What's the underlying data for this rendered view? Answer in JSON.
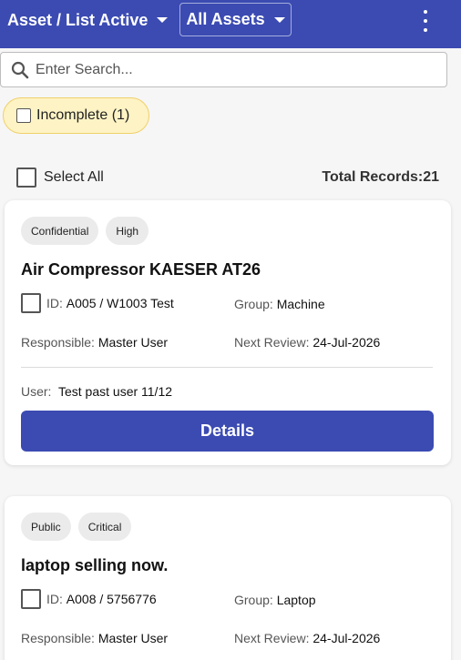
{
  "topbar": {
    "title": "Asset / List Active",
    "asset_filter": "All Assets",
    "icons": {
      "title_caret": "chevron-down-icon",
      "filter_caret": "chevron-down-icon",
      "menu": "more-vert-icon"
    },
    "color": "#3b4bb2"
  },
  "search": {
    "placeholder": "Enter Search...",
    "value": "",
    "icon": "search-icon"
  },
  "incomplete_chip": {
    "label": "Incomplete (1)",
    "checked": false
  },
  "select_all": {
    "label": "Select All",
    "checked": false
  },
  "total_records": "Total Records:21",
  "labels": {
    "id": "ID:",
    "group": "Group:",
    "responsible": "Responsible:",
    "next_review": "Next Review:",
    "user": "User:",
    "details": "Details"
  },
  "cards": [
    {
      "tags": [
        "Confidential",
        "High"
      ],
      "title": "Air Compressor KAESER AT26",
      "id": "A005 / W1003 Test",
      "group": "Machine",
      "responsible": "Master User",
      "next_review": "24-Jul-2026",
      "user": "Test past user 11/12"
    },
    {
      "tags": [
        "Public",
        "Critical"
      ],
      "title": "laptop selling now.",
      "id": "A008 / 5756776",
      "group": "Laptop",
      "responsible": "Master User",
      "next_review": "24-Jul-2026"
    }
  ]
}
